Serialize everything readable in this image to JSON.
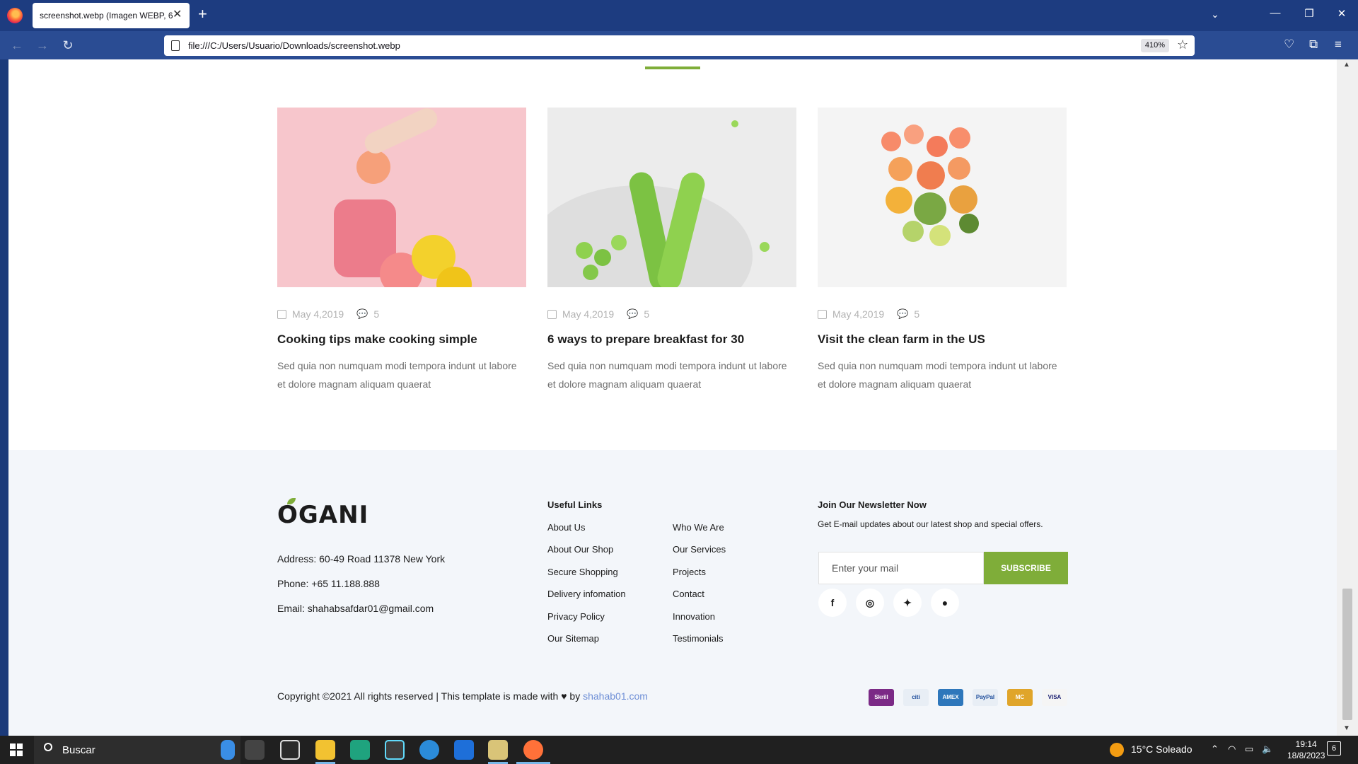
{
  "browser": {
    "tab_title": "screenshot.webp (Imagen WEBP, 6",
    "url": "file:///C:/Users/Usuario/Downloads/screenshot.webp",
    "zoom": "410%"
  },
  "blog": {
    "posts": [
      {
        "date": "May 4,2019",
        "comments": "5",
        "title": "Cooking tips make cooking simple",
        "excerpt": "Sed quia non numquam modi tempora indunt ut labore et dolore magnam aliquam quaerat"
      },
      {
        "date": "May 4,2019",
        "comments": "5",
        "title": "6 ways to prepare breakfast for 30",
        "excerpt": "Sed quia non numquam modi tempora indunt ut labore et dolore magnam aliquam quaerat"
      },
      {
        "date": "May 4,2019",
        "comments": "5",
        "title": "Visit the clean farm in the US",
        "excerpt": "Sed quia non numquam modi tempora indunt ut labore et dolore magnam aliquam quaerat"
      }
    ]
  },
  "footer": {
    "logo": "OGANI",
    "address": "Address: 60-49 Road 11378 New York",
    "phone": "Phone: +65 11.188.888",
    "email": "Email: shahabsafdar01@gmail.com",
    "useful_links_heading": "Useful Links",
    "links_col1": [
      "About Us",
      "About Our Shop",
      "Secure Shopping",
      "Delivery infomation",
      "Privacy Policy",
      "Our Sitemap"
    ],
    "links_col2": [
      "Who We Are",
      "Our Services",
      "Projects",
      "Contact",
      "Innovation",
      "Testimonials"
    ],
    "newsletter_heading": "Join Our Newsletter Now",
    "newsletter_text": "Get E-mail updates about our latest shop and special offers.",
    "newsletter_placeholder": "Enter your mail",
    "subscribe_label": "SUBSCRIBE",
    "social_icons": [
      "facebook-icon",
      "instagram-icon",
      "twitter-icon",
      "pinterest-icon"
    ],
    "copyright_prefix": "Copyright ©2021 All rights reserved | This template is made with",
    "copyright_by": "by",
    "copyright_link": "shahab01.com",
    "payment_methods": [
      "Skrill",
      "Citibank",
      "American Express",
      "PayPal",
      "MasterCard",
      "VISA"
    ],
    "accent_color": "#7fad39"
  },
  "taskbar": {
    "search_placeholder": "Buscar",
    "weather": "15°C  Soleado",
    "time": "19:14",
    "date": "18/8/2023",
    "notifications": "6"
  }
}
